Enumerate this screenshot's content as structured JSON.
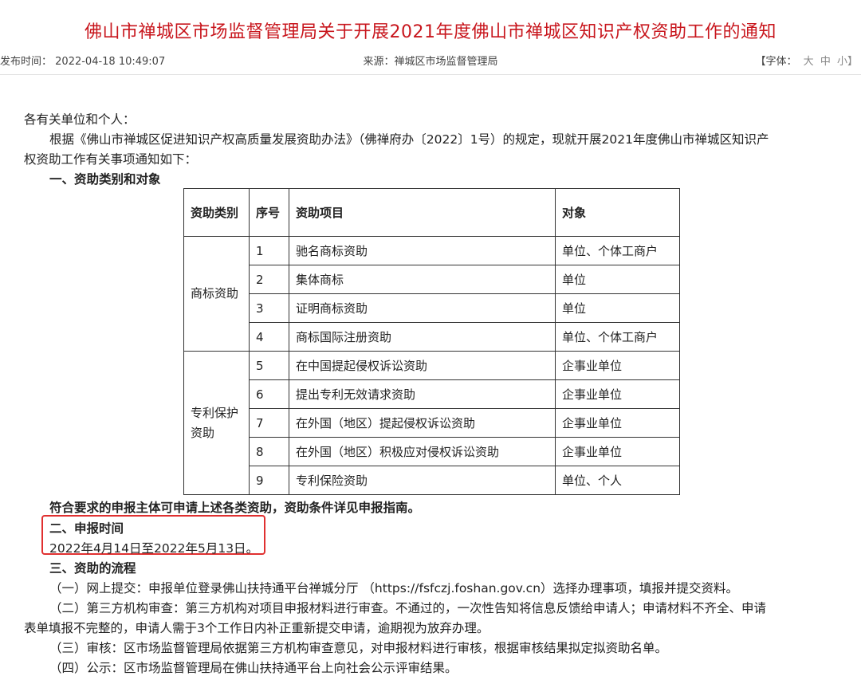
{
  "title": "佛山市禅城区市场监督管理局关于开展2021年度佛山市禅城区知识产权资助工作的通知",
  "meta": {
    "publish_label": "发布时间：",
    "publish_time": "2022-04-18 10:49:07",
    "source": "来源：禅城区市场监督管理局",
    "font_label": "【字体：",
    "font_large": "大",
    "font_medium": "中",
    "font_small": "小】"
  },
  "body": {
    "salutation": "各有关单位和个人：",
    "intro_line1": "根据《佛山市禅城区促进知识产权高质量发展资助办法》（佛禅府办〔2022〕1号）的规定，现就开展2021年度佛山市禅城区知识产",
    "intro_line2": "权资助工作有关事项通知如下：",
    "section1_heading": "一、资助类别和对象",
    "table_note": "符合要求的申报主体可申请上述各类资助，资助条件详见申报指南。",
    "section2_heading": "二、申报时间",
    "section2_text": "2022年4月14日至2022年5月13日。",
    "section3_heading": "三、资助的流程",
    "step1": "（一）网上提交：申报单位登录佛山扶持通平台禅城分厅 （https://fsfczj.foshan.gov.cn）选择办理事项，填报并提交资料。",
    "step2_line1": "（二）第三方机构审查：第三方机构对项目申报材料进行审查。不通过的，一次性告知将信息反馈给申请人；申请材料不齐全、申请",
    "step2_line2": "表单填报不完整的，申请人需于3个工作日内补正重新提交申请，逾期视为放弃办理。",
    "step3": "（三）审核：区市场监督管理局依据第三方机构审查意见，对申报材料进行审核，根据审核结果拟定拟资助名单。",
    "step4": "（四）公示：区市场监督管理局在佛山扶持通平台上向社会公示评审结果。"
  },
  "table": {
    "headers": [
      "资助类别",
      "序号",
      "资助项目",
      "对象"
    ],
    "category_trademark": "商标资助",
    "category_patent": "专利保护资助",
    "rows": [
      {
        "no": "1",
        "item": "驰名商标资助",
        "target": "单位、个体工商户"
      },
      {
        "no": "2",
        "item": "集体商标",
        "target": "单位"
      },
      {
        "no": "3",
        "item": "证明商标资助",
        "target": "单位"
      },
      {
        "no": "4",
        "item": "商标国际注册资助",
        "target": "单位、个体工商户"
      },
      {
        "no": "5",
        "item": "在中国提起侵权诉讼资助",
        "target": "企事业单位"
      },
      {
        "no": "6",
        "item": "提出专利无效请求资助",
        "target": "企事业单位"
      },
      {
        "no": "7",
        "item": "在外国（地区）提起侵权诉讼资助",
        "target": "企事业单位"
      },
      {
        "no": "8",
        "item": "在外国（地区）积极应对侵权诉讼资助",
        "target": "企事业单位"
      },
      {
        "no": "9",
        "item": "专利保险资助",
        "target": "单位、个人"
      }
    ]
  },
  "colors": {
    "title": "#c8161d",
    "highlight": "#e03030"
  }
}
